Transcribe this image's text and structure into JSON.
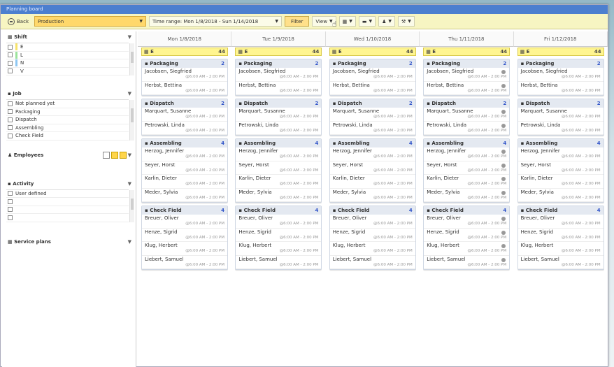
{
  "window": {
    "title": "Planning board"
  },
  "toolbar": {
    "back_label": "Back",
    "unit_value": "Production",
    "range_label": "Time range:",
    "range_value": "Mon 1/8/2018 - Sun 1/14/2018",
    "filter_label": "Filter",
    "view_label": "View"
  },
  "sidebar": {
    "shift": {
      "title": "Shift",
      "items": [
        {
          "label": "E",
          "color": "#f7e36a"
        },
        {
          "label": "L",
          "color": "#9be39b"
        },
        {
          "label": "N",
          "color": "#8ec7f2"
        },
        {
          "label": "V",
          "color": ""
        }
      ]
    },
    "job": {
      "title": "Job",
      "items": [
        "Not planned yet",
        "Packaging",
        "Dispatch",
        "Assembling",
        "Check Field"
      ]
    },
    "employees": {
      "title": "Employees"
    },
    "activity": {
      "title": "Activity",
      "items": [
        "User defined",
        "",
        "",
        ""
      ]
    },
    "service_plans": {
      "title": "Service plans"
    }
  },
  "days": [
    {
      "label": "Mon 1/8/2018"
    },
    {
      "label": "Tue 1/9/2018"
    },
    {
      "label": "Wed 1/10/2018"
    },
    {
      "label": "Thu 1/11/2018"
    },
    {
      "label": "Fri 1/12/2018"
    }
  ],
  "board": {
    "shift_label": "E",
    "shift_count": "44",
    "jobs": [
      {
        "name": "Packaging",
        "count": "2",
        "people": [
          {
            "name": "Jacobsen, Siegfried",
            "time": "@6:00 AM - 2:00 PM"
          },
          {
            "name": "Herbst, Bettina",
            "time": "@6:00 AM - 2:00 PM"
          }
        ]
      },
      {
        "name": "Dispatch",
        "count": "2",
        "people": [
          {
            "name": "Marquart, Susanne",
            "time": "@6:00 AM - 2:00 PM"
          },
          {
            "name": "Petrowski, Linda",
            "time": "@6:00 AM - 2:00 PM"
          }
        ]
      },
      {
        "name": "Assembling",
        "count": "4",
        "people": [
          {
            "name": "Herzog, Jennifer",
            "time": "@6:00 AM - 2:00 PM"
          },
          {
            "name": "Seyer, Horst",
            "time": "@6:00 AM - 2:00 PM"
          },
          {
            "name": "Karlin, Dieter",
            "time": "@6:00 AM - 2:00 PM"
          },
          {
            "name": "Meder, Sylvia",
            "time": "@6:00 AM - 2:00 PM"
          }
        ]
      },
      {
        "name": "Check Field",
        "count": "4",
        "people": [
          {
            "name": "Breuer, Oliver",
            "time": "@6:00 AM - 2:00 PM"
          },
          {
            "name": "Henze, Sigrid",
            "time": "@6:00 AM - 2:00 PM"
          },
          {
            "name": "Klug, Herbert",
            "time": "@6:00 AM - 2:00 PM"
          },
          {
            "name": "Liebert, Samuel",
            "time": "@6:00 AM - 2:00 PM"
          }
        ]
      }
    ]
  }
}
